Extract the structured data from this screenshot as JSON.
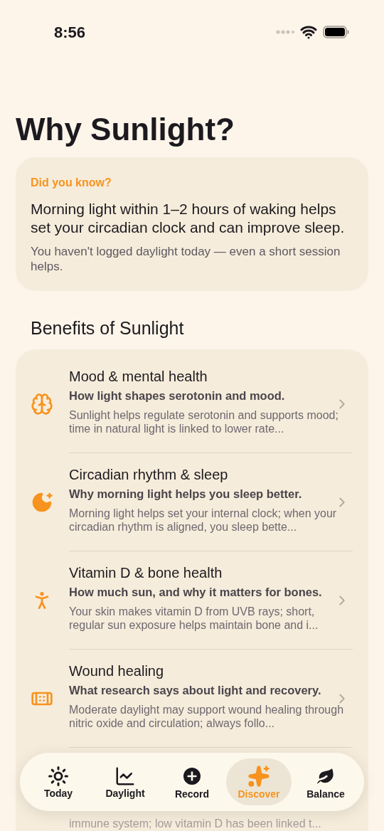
{
  "status_bar": {
    "time": "8:56"
  },
  "title": "Why Sunlight?",
  "tip_card": {
    "eyebrow": "Did you know?",
    "headline": "Morning light within 1–2 hours of waking helps set your circadian clock and can improve sleep.",
    "note": "You haven't logged daylight today — even a short session helps."
  },
  "benefits": {
    "heading": "Benefits of Sunlight",
    "items": [
      {
        "title": "Mood & mental health",
        "subtitle": "How light shapes serotonin and mood.",
        "description": "Sunlight helps regulate serotonin and supports mood; time in natural light is linked to lower rate..."
      },
      {
        "title": "Circadian rhythm & sleep",
        "subtitle": "Why morning light helps you sleep better.",
        "description": "Morning light helps set your internal clock; when your circadian rhythm is aligned, you sleep bette..."
      },
      {
        "title": "Vitamin D & bone health",
        "subtitle": "How much sun, and why it matters for bones.",
        "description": "Your skin makes vitamin D from UVB rays; short, regular sun exposure helps maintain bone and i..."
      },
      {
        "title": "Wound healing",
        "subtitle": "What research says about light and recovery.",
        "description": "Moderate daylight may support wound healing through nitric oxide and circulation; always follo..."
      },
      {
        "description": "immune system; low vitamin D has been linked t..."
      }
    ]
  },
  "tab_bar": [
    {
      "label": "Today",
      "selected": false
    },
    {
      "label": "Daylight",
      "selected": false
    },
    {
      "label": "Record",
      "selected": false
    },
    {
      "label": "Discover",
      "selected": true
    },
    {
      "label": "Balance",
      "selected": false
    }
  ]
}
